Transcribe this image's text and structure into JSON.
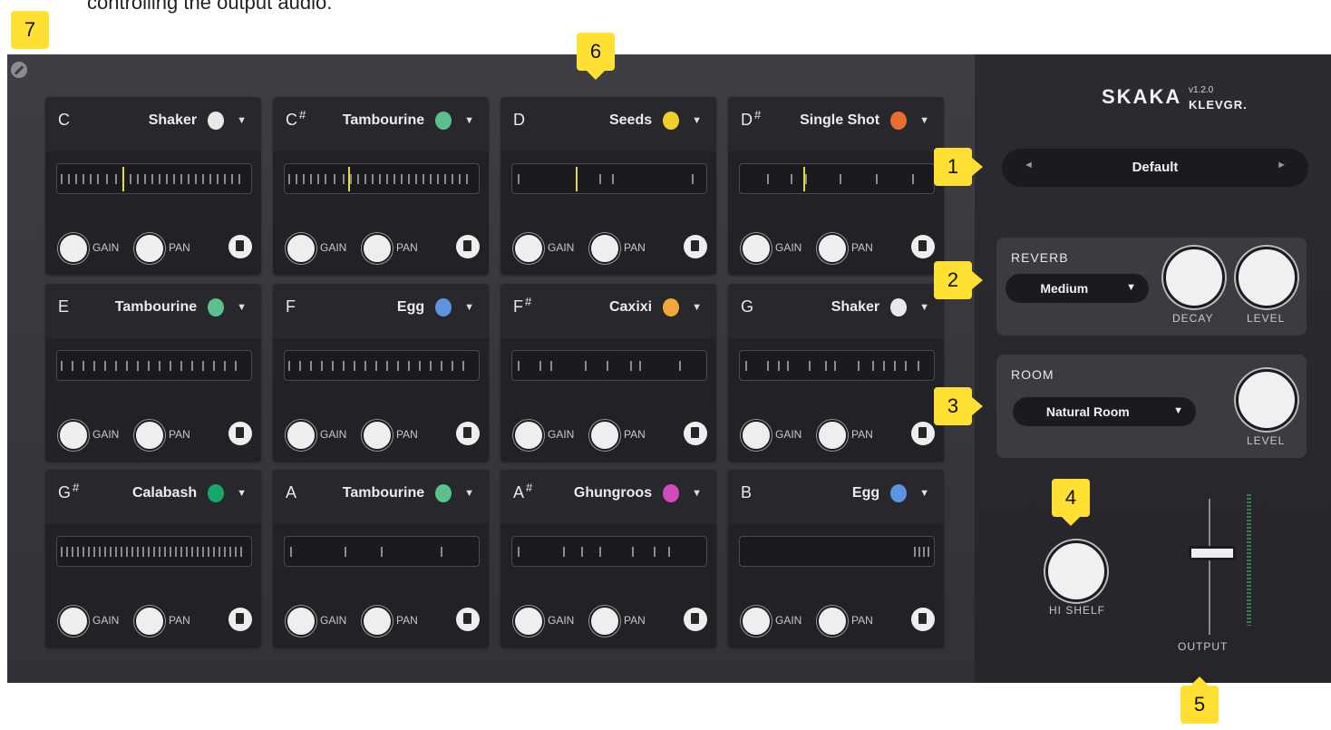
{
  "caption": "controlling the output audio.",
  "pads": [
    {
      "note": "C",
      "sharp": "",
      "instrument": "Shaker",
      "icon": "shaker-icon",
      "gain": "GAIN",
      "pan": "PAN"
    },
    {
      "note": "C",
      "sharp": "#",
      "instrument": "Tambourine",
      "icon": "tambourine-icon",
      "gain": "GAIN",
      "pan": "PAN"
    },
    {
      "note": "D",
      "sharp": "",
      "instrument": "Seeds",
      "icon": "seeds-icon",
      "gain": "GAIN",
      "pan": "PAN"
    },
    {
      "note": "D",
      "sharp": "#",
      "instrument": "Single Shot",
      "icon": "single-shot-icon",
      "gain": "GAIN",
      "pan": "PAN"
    },
    {
      "note": "E",
      "sharp": "",
      "instrument": "Tambourine",
      "icon": "tambourine-icon",
      "gain": "GAIN",
      "pan": "PAN"
    },
    {
      "note": "F",
      "sharp": "",
      "instrument": "Egg",
      "icon": "egg-icon",
      "gain": "GAIN",
      "pan": "PAN"
    },
    {
      "note": "F",
      "sharp": "#",
      "instrument": "Caxixi",
      "icon": "caxixi-icon",
      "gain": "GAIN",
      "pan": "PAN"
    },
    {
      "note": "G",
      "sharp": "",
      "instrument": "Shaker",
      "icon": "shaker-icon",
      "gain": "GAIN",
      "pan": "PAN"
    },
    {
      "note": "G",
      "sharp": "#",
      "instrument": "Calabash",
      "icon": "calabash-icon",
      "gain": "GAIN",
      "pan": "PAN"
    },
    {
      "note": "A",
      "sharp": "",
      "instrument": "Tambourine",
      "icon": "tambourine-icon",
      "gain": "GAIN",
      "pan": "PAN"
    },
    {
      "note": "A",
      "sharp": "#",
      "instrument": "Ghungroos",
      "icon": "ghungroos-icon",
      "gain": "GAIN",
      "pan": "PAN"
    },
    {
      "note": "B",
      "sharp": "",
      "instrument": "Egg",
      "icon": "egg-icon",
      "gain": "GAIN",
      "pan": "PAN"
    }
  ],
  "logo": {
    "name": "SKAKA",
    "version": "v1.2.0",
    "brand": "KLEVGR."
  },
  "preset": {
    "name": "Default"
  },
  "reverb": {
    "title": "REVERB",
    "mode": "Medium",
    "decay_label": "DECAY",
    "level_label": "LEVEL"
  },
  "room": {
    "title": "ROOM",
    "mode": "Natural Room",
    "level_label": "LEVEL"
  },
  "hishelf": {
    "label": "HI SHELF"
  },
  "output": {
    "label": "OUTPUT"
  },
  "callouts": [
    "1",
    "2",
    "3",
    "4",
    "5",
    "6",
    "7"
  ],
  "colors": {
    "selected_tick": "#e8dc3a",
    "pad_bg": "#222126",
    "panel_bg": "#2d2c31",
    "callout": "#ffe033"
  }
}
